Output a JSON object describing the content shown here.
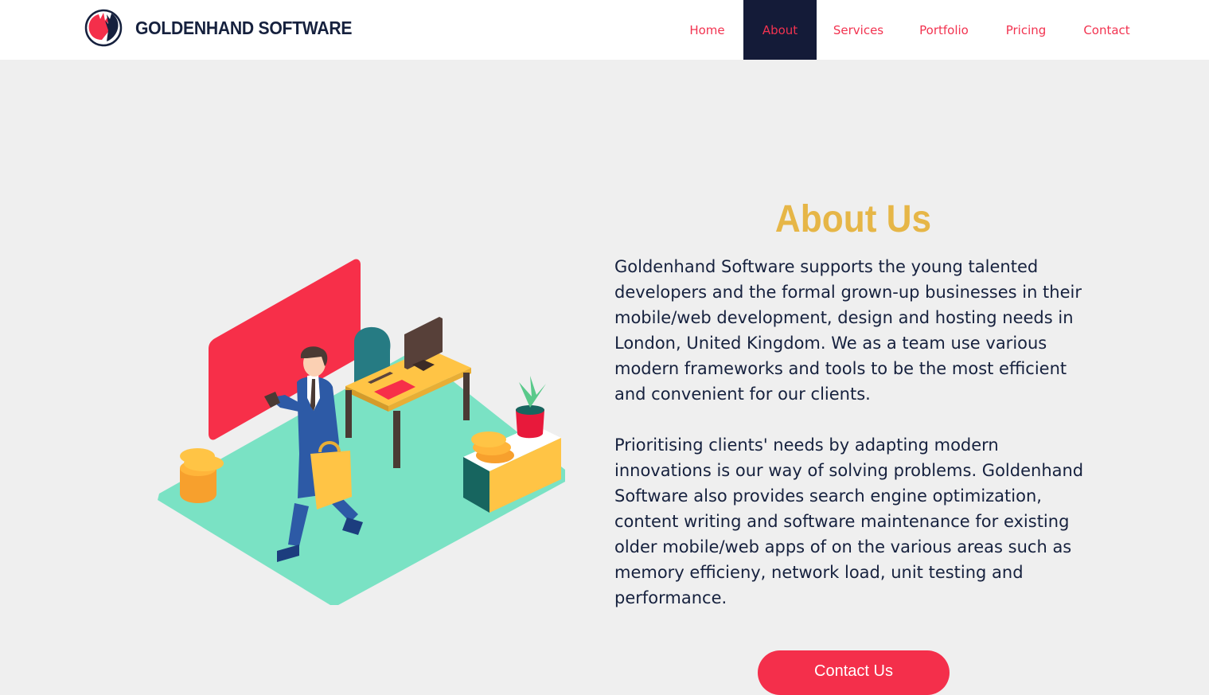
{
  "brand": {
    "name": "GOLDENHAND SOFTWARE",
    "logo_icon": "hands-logo-icon"
  },
  "nav": {
    "items": [
      {
        "label": "Home",
        "active": false
      },
      {
        "label": "About",
        "active": true
      },
      {
        "label": "Services",
        "active": false
      },
      {
        "label": "Portfolio",
        "active": false
      },
      {
        "label": "Pricing",
        "active": false
      },
      {
        "label": "Contact",
        "active": false
      }
    ]
  },
  "about": {
    "title": "About Us",
    "paragraph1": "Goldenhand Software supports the young talented developers and the formal grown-up businesses in their mobile/web development, design and hosting needs in London, United Kingdom. We as a team use various modern frameworks and tools to be the most efficient and convenient for our clients.",
    "paragraph2": "Prioritising clients' needs by adapting modern innovations is our way of solving problems. Goldenhand Software also provides search engine optimization, content writing and software maintenance for existing older mobile/web apps of on the various areas such as memory efficieny, network load, unit testing and performance.",
    "cta_label": "Contact Us"
  },
  "colors": {
    "accent_red": "#f42f4b",
    "navy": "#16213e",
    "gold": "#e6b647",
    "background": "#efefef"
  }
}
